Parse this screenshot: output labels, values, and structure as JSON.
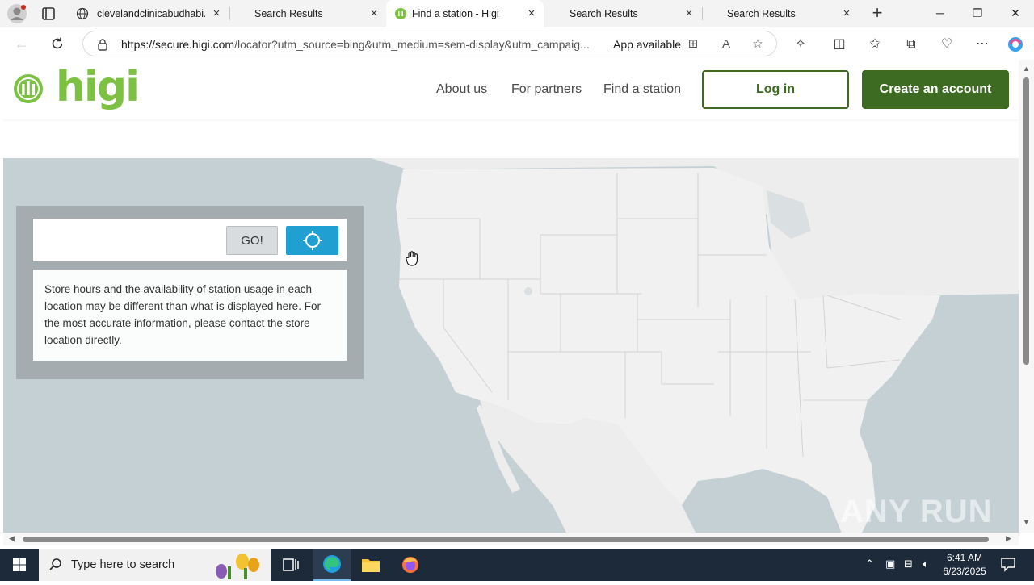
{
  "browser": {
    "tabs": [
      {
        "title": "clevelandclinicabudhabi.ae",
        "active": false
      },
      {
        "title": "Search Results",
        "active": false
      },
      {
        "title": "Find a station - Higi",
        "active": true
      },
      {
        "title": "Search Results",
        "active": false
      },
      {
        "title": "Search Results",
        "active": false
      }
    ],
    "url_host": "https://secure.higi.com",
    "url_path": "/locator?utm_source=bing&utm_medium=sem-display&utm_campaig...",
    "app_available": "App available"
  },
  "site": {
    "logo_text": "higi",
    "nav": [
      {
        "label": "About us"
      },
      {
        "label": "For partners"
      },
      {
        "label": "Find a station",
        "current": true
      }
    ],
    "login_label": "Log in",
    "create_label": "Create an account",
    "brand_green": "#7cc142",
    "dark_green": "#3d6b21",
    "accent_blue": "#1f9fd2"
  },
  "locator": {
    "search_value": "",
    "go_label": "GO!",
    "notice": "Store hours and the availability of station usage in each location may be different than what is displayed here. For the most accurate information, please contact the store location directly."
  },
  "taskbar": {
    "search_placeholder": "Type here to search",
    "time": "6:41 AM",
    "date": "6/23/2025"
  },
  "watermark": "ANY RUN"
}
